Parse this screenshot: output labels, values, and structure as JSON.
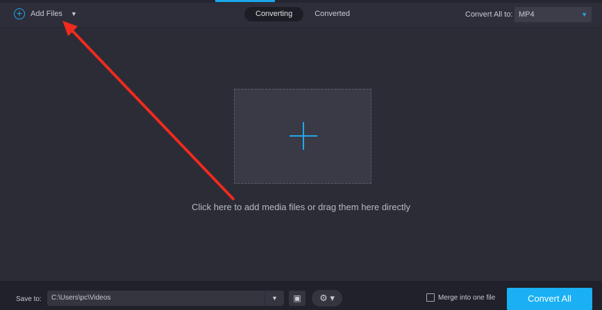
{
  "header": {
    "add_files": "Add Files",
    "tabs": [
      {
        "label": "Converting",
        "active": true
      },
      {
        "label": "Converted",
        "active": false
      }
    ],
    "convert_all_to_label": "Convert All to:",
    "format": "MP4"
  },
  "main": {
    "hint": "Click here to add media files or drag them here directly"
  },
  "footer": {
    "save_to_label": "Save to:",
    "path": "C:\\Users\\pc\\Videos",
    "merge_label": "Merge into one file",
    "merge_checked": false,
    "convert_all": "Convert All"
  },
  "colors": {
    "accent": "#1ab0f3",
    "annotation_arrow": "#f02a1e"
  }
}
